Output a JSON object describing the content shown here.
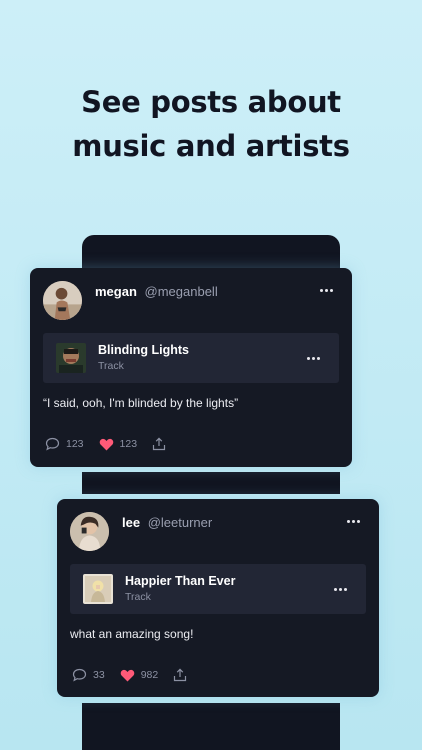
{
  "headline": {
    "line1": "See posts about",
    "line2": "music and artists"
  },
  "posts": [
    {
      "user_name": "megan",
      "user_handle": "@meganbell",
      "track_title": "Blinding Lights",
      "track_type": "Track",
      "text": "“I said, ooh, I'm blinded by the lights”",
      "comments": "123",
      "likes": "123",
      "icons": {
        "comment": "comment-icon",
        "like": "heart-icon",
        "share": "share-icon",
        "more": "more-dots-icon"
      }
    },
    {
      "user_name": "lee",
      "user_handle": "@leeturner",
      "track_title": "Happier Than Ever",
      "track_type": "Track",
      "text": "what an amazing song!",
      "comments": "33",
      "likes": "982",
      "icons": {
        "comment": "comment-icon",
        "like": "heart-icon",
        "share": "share-icon",
        "more": "more-dots-icon"
      }
    }
  ],
  "colors": {
    "background": "#c4ecf6",
    "card": "#151924",
    "track_row": "#222635",
    "heart": "#ff5a78",
    "muted_text": "#8c91a3"
  }
}
